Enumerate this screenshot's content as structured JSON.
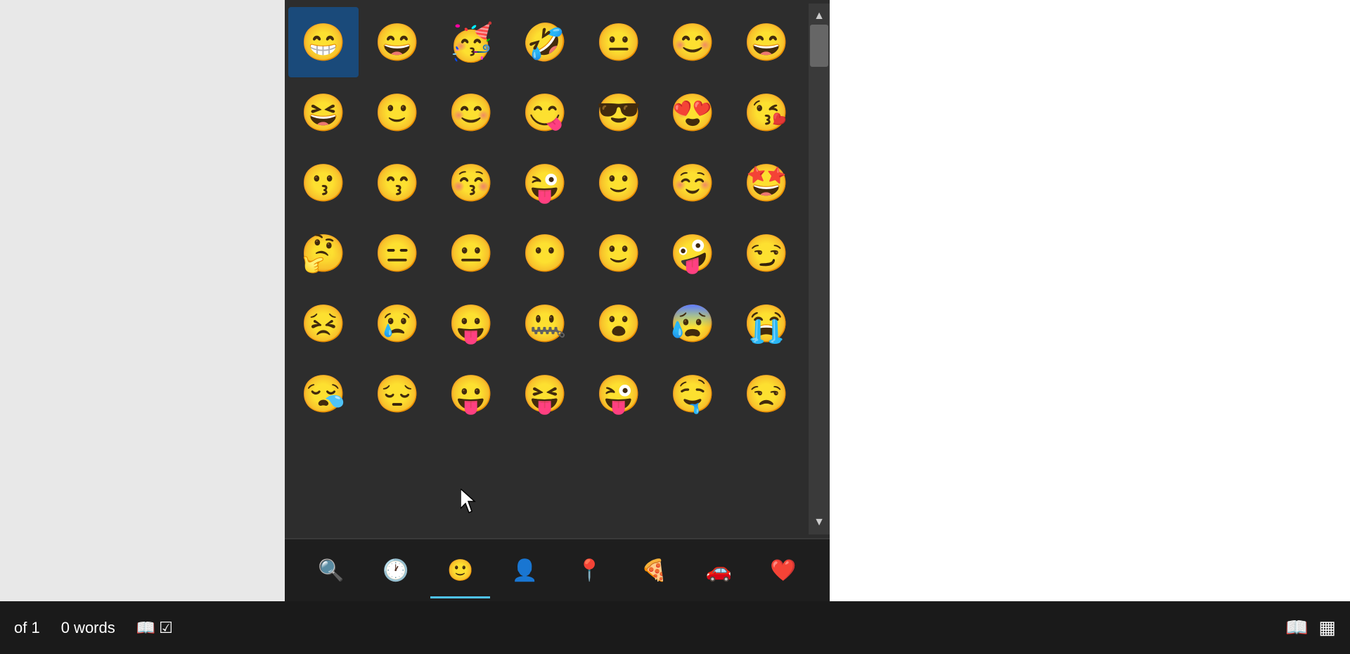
{
  "status_bar": {
    "page_info": "of 1",
    "word_count": "0 words",
    "bg_color": "#1a1a1a"
  },
  "emoji_picker": {
    "bg_color": "#2d2d2d",
    "emojis": [
      "😁",
      "😄",
      "🥳",
      "🤣",
      "😐",
      "😊",
      "😄",
      "😆",
      "🙂",
      "😊",
      "😋",
      "😎",
      "😍",
      "😘",
      "😗",
      "😙",
      "😚",
      "😜",
      "🙂",
      "☺️",
      "🤩",
      "🤔",
      "😑",
      "😐",
      "😶",
      "🙂",
      "🤪",
      "😏",
      "😣",
      "😢",
      "😛",
      "🤐",
      "😮",
      "😰",
      "😭",
      "😪",
      "😔",
      "😛",
      "😝",
      "😜",
      "🤤",
      "😒"
    ],
    "categories": [
      {
        "icon": "🔍",
        "name": "search",
        "active": false
      },
      {
        "icon": "🕐",
        "name": "recent",
        "active": false
      },
      {
        "icon": "😊",
        "name": "smileys",
        "active": true
      },
      {
        "icon": "👤",
        "name": "people",
        "active": false
      },
      {
        "icon": "📍",
        "name": "nature",
        "active": false
      },
      {
        "icon": "🍕",
        "name": "food",
        "active": false
      },
      {
        "icon": "🚗",
        "name": "travel",
        "active": false
      },
      {
        "icon": "❤️",
        "name": "symbols",
        "active": false
      }
    ]
  },
  "icons": {
    "scroll_up": "▲",
    "scroll_down": "▼",
    "book_icon": "📖",
    "grid_icon": "▦",
    "search_icon": "🔍",
    "recent_icon": "🕐",
    "smiley_icon": "😊",
    "people_icon": "👤",
    "pin_icon": "📍",
    "pizza_icon": "🍕",
    "car_icon": "🚗",
    "heart_icon": "❤️"
  }
}
